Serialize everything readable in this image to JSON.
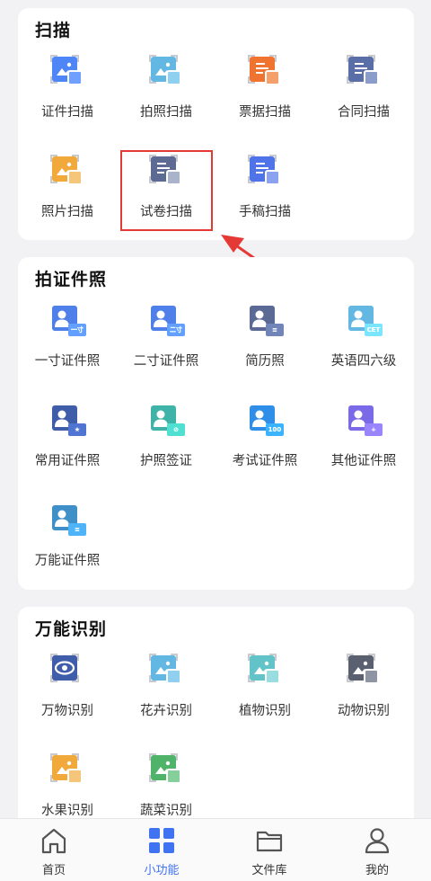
{
  "sections": [
    {
      "title": "扫描",
      "items": [
        {
          "label": "证件扫描",
          "icon": "id-card-scan-icon",
          "color": "#4f86f7",
          "badge": "#6fa0ff"
        },
        {
          "label": "拍照扫描",
          "icon": "photo-scan-icon",
          "color": "#62b7e3",
          "badge": "#8fd0f0"
        },
        {
          "label": "票据扫描",
          "icon": "receipt-scan-icon",
          "color": "#f0732f",
          "badge": "#f5a06a"
        },
        {
          "label": "合同扫描",
          "icon": "contract-scan-icon",
          "color": "#5a6fa8",
          "badge": "#8a9cc9"
        },
        {
          "label": "照片扫描",
          "icon": "picture-scan-icon",
          "color": "#f2a93b",
          "badge": "#f5c67a"
        },
        {
          "label": "试卷扫描",
          "icon": "exam-paper-scan-icon",
          "color": "#5c6a94",
          "badge": "#aab3cc"
        },
        {
          "label": "手稿扫描",
          "icon": "manuscript-scan-icon",
          "color": "#4f73e8",
          "badge": "#8aa2f0"
        }
      ]
    },
    {
      "title": "拍证件照",
      "items": [
        {
          "label": "一寸证件照",
          "icon": "one-inch-photo-icon",
          "color": "#4f7fe8",
          "badge_text": "一寸"
        },
        {
          "label": "二寸证件照",
          "icon": "two-inch-photo-icon",
          "color": "#4f7fe8",
          "badge_text": "二寸"
        },
        {
          "label": "简历照",
          "icon": "resume-photo-icon",
          "color": "#5b6a94",
          "badge_text": "≡"
        },
        {
          "label": "英语四六级",
          "icon": "cet-photo-icon",
          "color": "#62b7e3",
          "badge_text": "CET"
        },
        {
          "label": "常用证件照",
          "icon": "common-photo-icon",
          "color": "#3f5da8",
          "badge_text": "★"
        },
        {
          "label": "护照签证",
          "icon": "passport-visa-icon",
          "color": "#3fb3a8",
          "badge_text": "⊘"
        },
        {
          "label": "考试证件照",
          "icon": "exam-photo-icon",
          "color": "#2f8fe8",
          "badge_text": "100"
        },
        {
          "label": "其他证件照",
          "icon": "other-photo-icon",
          "color": "#7b6ae8",
          "badge_text": "+"
        },
        {
          "label": "万能证件照",
          "icon": "universal-photo-icon",
          "color": "#3f8fc8",
          "badge_text": "≡"
        }
      ]
    },
    {
      "title": "万能识别",
      "items": [
        {
          "label": "万物识别",
          "icon": "eye-recognize-icon",
          "color": "#3f5da8",
          "badge": ""
        },
        {
          "label": "花卉识别",
          "icon": "flower-recognize-icon",
          "color": "#62b7e3",
          "badge": "#8fd0f0"
        },
        {
          "label": "植物识别",
          "icon": "plant-recognize-icon",
          "color": "#62c4c8",
          "badge": "#9adde0"
        },
        {
          "label": "动物识别",
          "icon": "animal-recognize-icon",
          "color": "#5a6070",
          "badge": "#8e94a4"
        },
        {
          "label": "水果识别",
          "icon": "fruit-recognize-icon",
          "color": "#f2a93b",
          "badge": "#f5c67a"
        },
        {
          "label": "蔬菜识别",
          "icon": "vegetable-recognize-icon",
          "color": "#4fb36a",
          "badge": "#85d09a"
        }
      ]
    }
  ],
  "tabbar": [
    {
      "label": "首页",
      "icon": "home-icon",
      "active": false
    },
    {
      "label": "小功能",
      "icon": "grid-icon",
      "active": true
    },
    {
      "label": "文件库",
      "icon": "folder-icon",
      "active": false
    },
    {
      "label": "我的",
      "icon": "user-icon",
      "active": false
    }
  ],
  "colors": {
    "accent": "#3f73f2",
    "highlight": "#e53935"
  }
}
